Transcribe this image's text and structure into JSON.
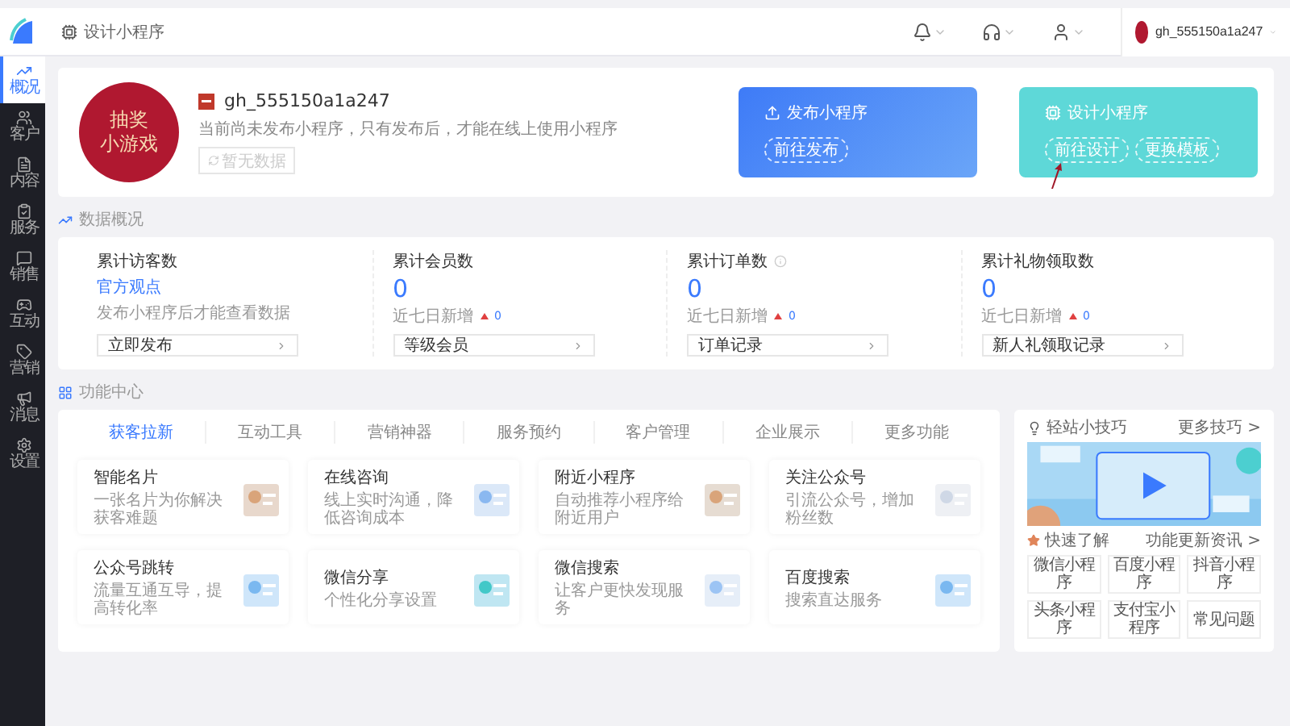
{
  "header": {
    "breadcrumb": "设计小程序",
    "account": "gh_555150a1a247"
  },
  "sidebar": {
    "items": [
      {
        "label": "概况",
        "selected": true
      },
      {
        "label": "客户",
        "selected": false
      },
      {
        "label": "内容",
        "selected": false
      },
      {
        "label": "服务",
        "selected": false
      },
      {
        "label": "销售",
        "selected": false
      },
      {
        "label": "互动",
        "selected": false
      },
      {
        "label": "营销",
        "selected": false
      },
      {
        "label": "消息",
        "selected": false
      },
      {
        "label": "设置",
        "selected": false
      }
    ]
  },
  "profile": {
    "avatar_lines": [
      "抽奖",
      "小游戏"
    ],
    "name": "gh_555150a1a247",
    "description": "当前尚未发布小程序，只有发布后，才能在线上使用小程序",
    "button": {
      "label": "暂无数据",
      "disabled": true
    }
  },
  "action_cards": [
    {
      "kind": "publish",
      "title": "发布小程序",
      "buttons": [
        "前往发布"
      ]
    },
    {
      "kind": "design",
      "title": "设计小程序",
      "buttons": [
        "前往设计",
        "更换模板"
      ]
    }
  ],
  "data_overview": {
    "title": "数据概况",
    "stats": [
      {
        "label": "累计访客数",
        "link": "官方观点",
        "note": "发布小程序后才能查看数据",
        "button": "立即发布"
      },
      {
        "label": "累计会员数",
        "value": "0",
        "trend_label": "近七日新增",
        "trend_value": "0",
        "button": "等级会员"
      },
      {
        "label": "累计订单数",
        "info": true,
        "value": "0",
        "trend_label": "近七日新增",
        "trend_value": "0",
        "button": "订单记录"
      },
      {
        "label": "累计礼物领取数",
        "value": "0",
        "trend_label": "近七日新增",
        "trend_value": "0",
        "button": "新人礼领取记录"
      }
    ]
  },
  "function_center": {
    "title": "功能中心",
    "tabs": [
      {
        "label": "获客拉新",
        "selected": true
      },
      {
        "label": "互动工具",
        "selected": false
      },
      {
        "label": "营销神器",
        "selected": false
      },
      {
        "label": "服务预约",
        "selected": false
      },
      {
        "label": "客户管理",
        "selected": false
      },
      {
        "label": "企业展示",
        "selected": false
      },
      {
        "label": "更多功能",
        "selected": false
      }
    ],
    "cards": [
      {
        "title": "智能名片",
        "subtitle": "一张名片为你解决获客难题"
      },
      {
        "title": "在线咨询",
        "subtitle": "线上实时沟通，降低咨询成本"
      },
      {
        "title": "附近小程序",
        "subtitle": "自动推荐小程序给附近用户"
      },
      {
        "title": "关注公众号",
        "subtitle": "引流公众号，增加粉丝数"
      },
      {
        "title": "公众号跳转",
        "subtitle": "流量互通互导，提高转化率"
      },
      {
        "title": "微信分享",
        "subtitle": "个性化分享设置"
      },
      {
        "title": "微信搜索",
        "subtitle": "让客户更快发现服务"
      },
      {
        "title": "百度搜索",
        "subtitle": "搜索直达服务"
      }
    ]
  },
  "tips": {
    "title": "轻站小技巧",
    "more": "更多技巧 >",
    "banner": {
      "kind": "picture"
    },
    "quick_title": "快速了解",
    "quick_more": "功能更新资讯 >",
    "links": [
      "微信小程序",
      "百度小程序",
      "抖音小程序",
      "头条小程序",
      "支付宝小程序",
      "常见问题"
    ]
  }
}
